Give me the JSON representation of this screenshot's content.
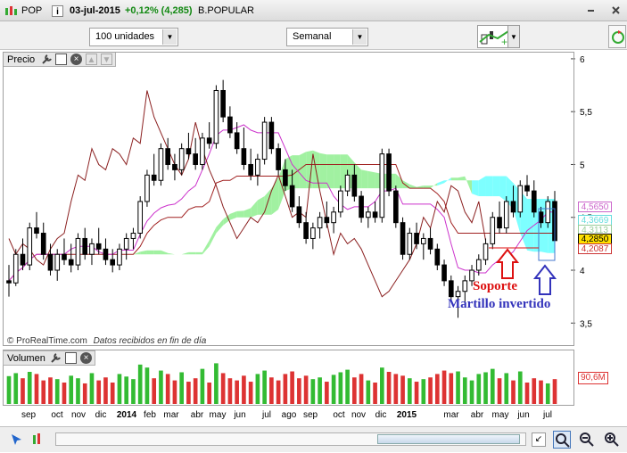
{
  "titlebar": {
    "symbol": "POP",
    "date": "03-jul-2015",
    "change": "+0,12% (4,285)",
    "name": "B.POPULAR",
    "menu_icon": "chart-menu-icon",
    "info_icon": "info-icon"
  },
  "toolbar": {
    "units_label": "100 unidades",
    "period_label": "Semanal"
  },
  "price_panel": {
    "title": "Precio",
    "watermark": "© ProRealTime.com",
    "watermark_note": "Datos recibidos en fin de día",
    "annotation_support": "Soporte",
    "annotation_hammer": "Martillo invertido",
    "price_labels": [
      {
        "text": "4,5650",
        "color": "#cc66cc"
      },
      {
        "text": "4,3669",
        "color": "#66dddd"
      },
      {
        "text": "4,3113",
        "color": "#99cc99"
      },
      {
        "text": "4,2850",
        "color": "#000000",
        "bg": "#ffe000"
      },
      {
        "text": "4,2087",
        "color": "#cc3333"
      }
    ]
  },
  "volume_panel": {
    "title": "Volumen",
    "volume_label": "90,6M"
  },
  "colors": {
    "cloud_bull": "#90ee90",
    "cloud_bear": "#66ffff",
    "tenkan": "#a02020",
    "kijun": "#cc33cc",
    "chikou": "#8b2020",
    "vol_up": "#33bb33",
    "vol_down": "#dd3333",
    "annot_red": "#dd1111",
    "annot_blue": "#3333bb"
  },
  "chart_data": {
    "type": "candlestick",
    "y_ticks": [
      "3,5",
      "4",
      "4,5",
      "5",
      "5,5",
      "6"
    ],
    "ylim": [
      3.3,
      6.05
    ],
    "x_ticks": [
      "sep",
      "oct",
      "nov",
      "dic",
      "2014",
      "feb",
      "mar",
      "abr",
      "may",
      "jun",
      "jul",
      "ago",
      "sep",
      "oct",
      "nov",
      "dic",
      "2015",
      "mar",
      "abr",
      "may",
      "jun",
      "jul"
    ],
    "candles": [
      [
        3.9,
        4.05,
        3.75,
        3.88
      ],
      [
        3.88,
        4.2,
        3.85,
        4.15
      ],
      [
        4.15,
        4.3,
        4.0,
        4.05
      ],
      [
        4.05,
        4.45,
        4.0,
        4.4
      ],
      [
        4.4,
        4.55,
        4.3,
        4.35
      ],
      [
        4.35,
        4.45,
        4.1,
        4.15
      ],
      [
        4.15,
        4.25,
        3.95,
        4.0
      ],
      [
        4.0,
        4.2,
        3.9,
        4.15
      ],
      [
        4.15,
        4.3,
        4.05,
        4.1
      ],
      [
        4.1,
        4.25,
        3.98,
        4.05
      ],
      [
        4.05,
        4.35,
        4.0,
        4.3
      ],
      [
        4.3,
        4.4,
        4.1,
        4.15
      ],
      [
        4.15,
        4.3,
        4.05,
        4.25
      ],
      [
        4.25,
        4.4,
        4.15,
        4.2
      ],
      [
        4.2,
        4.3,
        4.05,
        4.1
      ],
      [
        4.1,
        4.2,
        3.98,
        4.05
      ],
      [
        4.05,
        4.25,
        4.0,
        4.2
      ],
      [
        4.2,
        4.35,
        4.1,
        4.3
      ],
      [
        4.3,
        4.4,
        4.2,
        4.35
      ],
      [
        4.35,
        4.7,
        4.3,
        4.65
      ],
      [
        4.65,
        4.95,
        4.6,
        4.9
      ],
      [
        4.9,
        5.1,
        4.8,
        4.85
      ],
      [
        4.85,
        5.2,
        4.8,
        5.15
      ],
      [
        5.15,
        5.25,
        4.95,
        5.0
      ],
      [
        5.0,
        5.1,
        4.85,
        4.95
      ],
      [
        4.95,
        5.2,
        4.9,
        5.15
      ],
      [
        5.15,
        5.3,
        5.05,
        5.1
      ],
      [
        5.1,
        5.25,
        4.95,
        5.0
      ],
      [
        5.0,
        5.3,
        4.95,
        5.25
      ],
      [
        5.25,
        5.4,
        5.15,
        5.2
      ],
      [
        5.2,
        5.75,
        5.15,
        5.7
      ],
      [
        5.7,
        5.8,
        5.4,
        5.45
      ],
      [
        5.45,
        5.55,
        5.25,
        5.3
      ],
      [
        5.3,
        5.4,
        5.1,
        5.15
      ],
      [
        5.15,
        5.35,
        4.95,
        5.0
      ],
      [
        5.0,
        5.15,
        4.85,
        4.9
      ],
      [
        4.9,
        5.1,
        4.8,
        5.05
      ],
      [
        5.05,
        5.45,
        5.0,
        5.4
      ],
      [
        5.4,
        5.45,
        5.1,
        5.15
      ],
      [
        5.15,
        5.2,
        4.9,
        4.95
      ],
      [
        4.95,
        5.05,
        4.75,
        4.8
      ],
      [
        4.8,
        4.95,
        4.55,
        4.6
      ],
      [
        4.6,
        4.7,
        4.4,
        4.45
      ],
      [
        4.45,
        4.55,
        4.25,
        4.3
      ],
      [
        4.3,
        4.45,
        4.2,
        4.4
      ],
      [
        4.4,
        4.55,
        4.3,
        4.5
      ],
      [
        4.5,
        4.65,
        4.4,
        4.45
      ],
      [
        4.45,
        4.6,
        4.35,
        4.55
      ],
      [
        4.55,
        4.8,
        4.5,
        4.75
      ],
      [
        4.75,
        4.95,
        4.7,
        4.9
      ],
      [
        4.9,
        5.0,
        4.65,
        4.7
      ],
      [
        4.7,
        4.75,
        4.45,
        4.5
      ],
      [
        4.5,
        4.6,
        4.4,
        4.55
      ],
      [
        4.55,
        4.65,
        4.45,
        4.5
      ],
      [
        4.5,
        5.15,
        4.45,
        5.1
      ],
      [
        5.1,
        5.15,
        4.7,
        4.75
      ],
      [
        4.75,
        4.8,
        4.4,
        4.45
      ],
      [
        4.45,
        4.5,
        4.1,
        4.15
      ],
      [
        4.15,
        4.4,
        4.1,
        4.35
      ],
      [
        4.35,
        4.45,
        4.2,
        4.25
      ],
      [
        4.25,
        4.35,
        4.1,
        4.3
      ],
      [
        4.3,
        4.4,
        4.15,
        4.2
      ],
      [
        4.2,
        4.25,
        4.0,
        4.05
      ],
      [
        4.05,
        4.1,
        3.85,
        3.9
      ],
      [
        3.9,
        3.95,
        3.7,
        3.75
      ],
      [
        3.75,
        3.85,
        3.55,
        3.8
      ],
      [
        3.8,
        3.95,
        3.7,
        3.9
      ],
      [
        3.9,
        4.05,
        3.85,
        4.0
      ],
      [
        4.0,
        4.15,
        3.95,
        4.1
      ],
      [
        4.1,
        4.3,
        4.05,
        4.25
      ],
      [
        4.25,
        4.55,
        4.2,
        4.5
      ],
      [
        4.5,
        4.65,
        4.35,
        4.4
      ],
      [
        4.4,
        4.7,
        4.35,
        4.65
      ],
      [
        4.65,
        4.8,
        4.5,
        4.55
      ],
      [
        4.55,
        4.85,
        4.5,
        4.8
      ],
      [
        4.8,
        4.9,
        4.7,
        4.75
      ],
      [
        4.75,
        4.85,
        4.5,
        4.55
      ],
      [
        4.55,
        4.6,
        4.4,
        4.45
      ],
      [
        4.45,
        4.7,
        4.4,
        4.65
      ],
      [
        4.65,
        4.75,
        4.2,
        4.28
      ]
    ],
    "volume": [
      [
        0.65,
        1
      ],
      [
        0.72,
        1
      ],
      [
        0.6,
        0
      ],
      [
        0.75,
        1
      ],
      [
        0.7,
        0
      ],
      [
        0.55,
        0
      ],
      [
        0.62,
        0
      ],
      [
        0.58,
        1
      ],
      [
        0.5,
        0
      ],
      [
        0.66,
        1
      ],
      [
        0.6,
        1
      ],
      [
        0.48,
        0
      ],
      [
        0.72,
        1
      ],
      [
        0.55,
        0
      ],
      [
        0.62,
        0
      ],
      [
        0.5,
        0
      ],
      [
        0.7,
        1
      ],
      [
        0.64,
        1
      ],
      [
        0.58,
        1
      ],
      [
        0.92,
        1
      ],
      [
        0.85,
        1
      ],
      [
        0.6,
        0
      ],
      [
        0.78,
        1
      ],
      [
        0.7,
        0
      ],
      [
        0.55,
        0
      ],
      [
        0.74,
        1
      ],
      [
        0.52,
        0
      ],
      [
        0.6,
        0
      ],
      [
        0.82,
        1
      ],
      [
        0.5,
        0
      ],
      [
        0.95,
        1
      ],
      [
        0.72,
        0
      ],
      [
        0.6,
        0
      ],
      [
        0.55,
        0
      ],
      [
        0.66,
        0
      ],
      [
        0.52,
        0
      ],
      [
        0.7,
        1
      ],
      [
        0.78,
        1
      ],
      [
        0.62,
        0
      ],
      [
        0.55,
        0
      ],
      [
        0.7,
        0
      ],
      [
        0.76,
        0
      ],
      [
        0.6,
        0
      ],
      [
        0.66,
        0
      ],
      [
        0.58,
        1
      ],
      [
        0.62,
        1
      ],
      [
        0.52,
        0
      ],
      [
        0.68,
        1
      ],
      [
        0.74,
        1
      ],
      [
        0.8,
        1
      ],
      [
        0.62,
        0
      ],
      [
        0.7,
        0
      ],
      [
        0.55,
        1
      ],
      [
        0.5,
        0
      ],
      [
        0.85,
        1
      ],
      [
        0.75,
        0
      ],
      [
        0.7,
        0
      ],
      [
        0.66,
        0
      ],
      [
        0.6,
        1
      ],
      [
        0.52,
        0
      ],
      [
        0.58,
        1
      ],
      [
        0.62,
        0
      ],
      [
        0.7,
        0
      ],
      [
        0.78,
        0
      ],
      [
        0.72,
        0
      ],
      [
        0.76,
        1
      ],
      [
        0.62,
        1
      ],
      [
        0.55,
        1
      ],
      [
        0.7,
        1
      ],
      [
        0.74,
        1
      ],
      [
        0.82,
        1
      ],
      [
        0.6,
        0
      ],
      [
        0.72,
        1
      ],
      [
        0.55,
        0
      ],
      [
        0.76,
        1
      ],
      [
        0.5,
        0
      ],
      [
        0.6,
        0
      ],
      [
        0.55,
        0
      ],
      [
        0.48,
        1
      ],
      [
        0.58,
        0
      ]
    ]
  }
}
